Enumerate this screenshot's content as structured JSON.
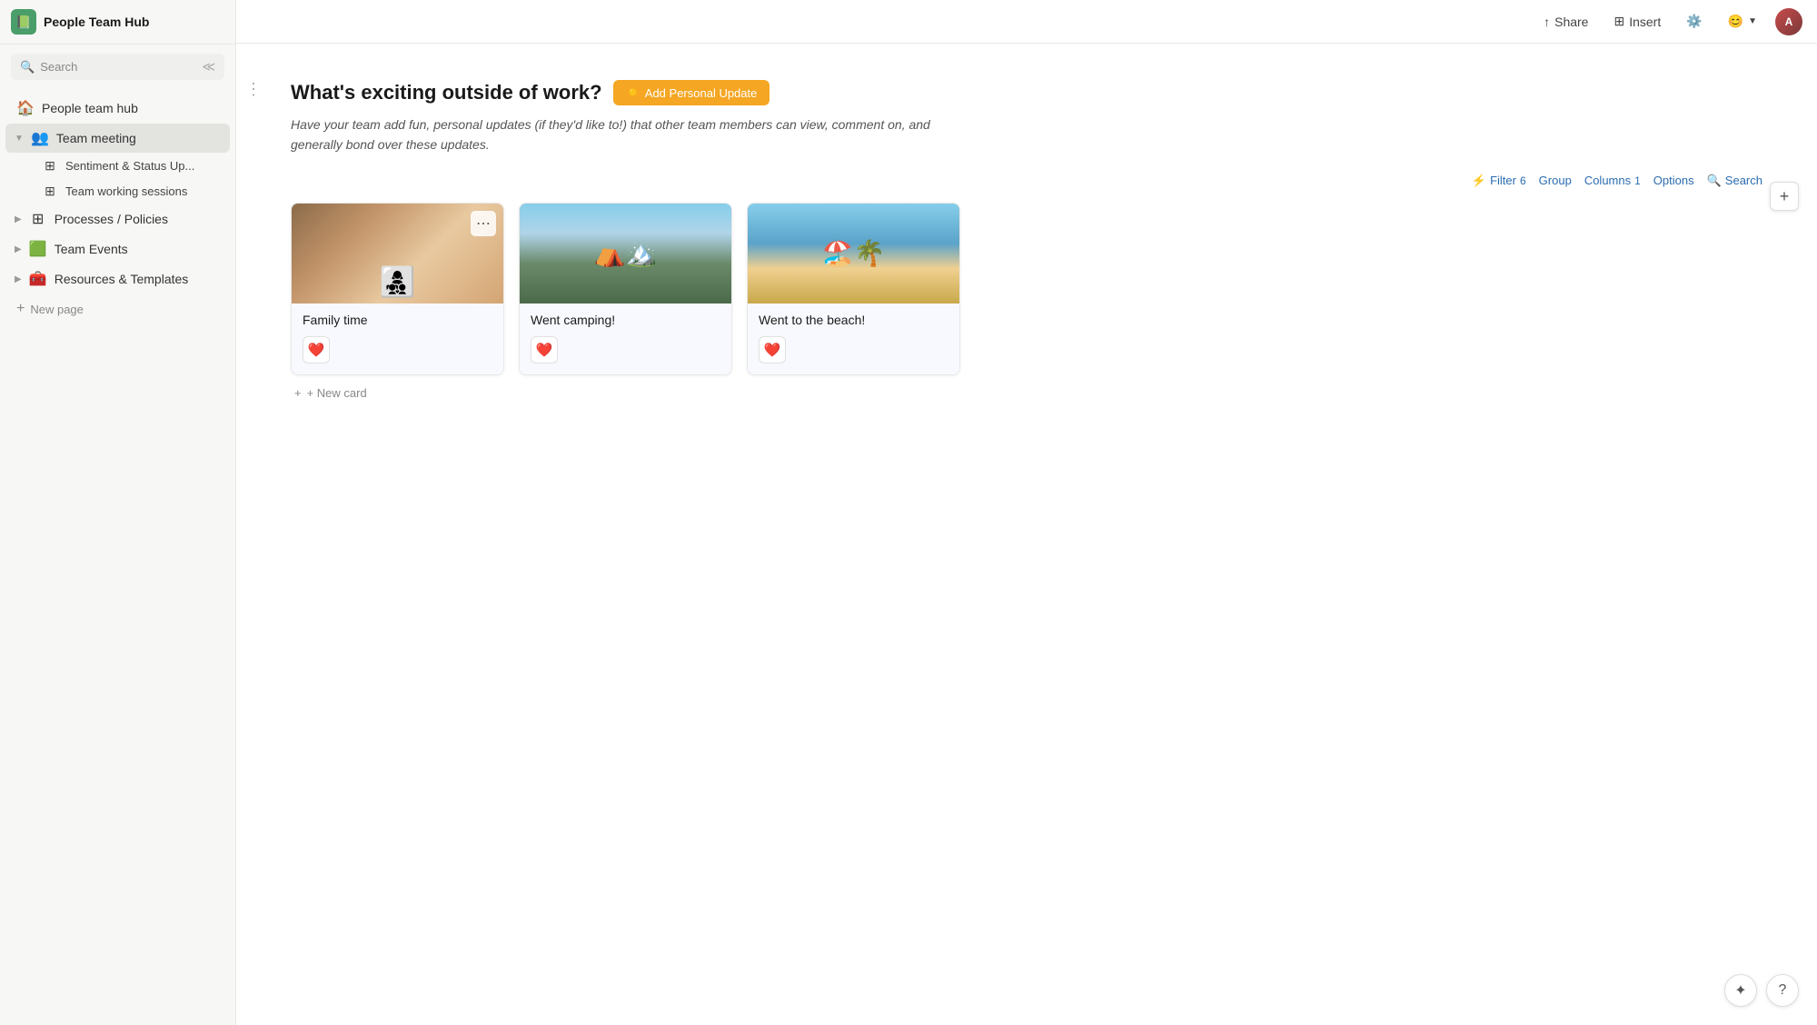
{
  "app": {
    "title": "People Team Hub",
    "logo_emoji": "🟩"
  },
  "sidebar": {
    "search_placeholder": "Search",
    "items": [
      {
        "id": "people-team-hub",
        "label": "People team hub",
        "icon": "🏠",
        "level": 0,
        "expanded": false
      },
      {
        "id": "team-meeting",
        "label": "Team meeting",
        "icon": "👥",
        "level": 0,
        "expanded": true,
        "active": true
      },
      {
        "id": "sentiment-status",
        "label": "Sentiment & Status Up...",
        "icon": "⊞",
        "level": 1
      },
      {
        "id": "team-working-sessions",
        "label": "Team working sessions",
        "icon": "⊞",
        "level": 1
      },
      {
        "id": "processes-policies",
        "label": "Processes / Policies",
        "icon": "⊞",
        "level": 0,
        "expanded": false
      },
      {
        "id": "team-events",
        "label": "Team Events",
        "icon": "🟩",
        "level": 0,
        "expanded": false
      },
      {
        "id": "resources-templates",
        "label": "Resources & Templates",
        "icon": "🧰",
        "level": 0,
        "expanded": false
      }
    ],
    "new_page_label": "New page"
  },
  "topbar": {
    "share_label": "Share",
    "insert_label": "Insert"
  },
  "main": {
    "section_title": "What's exciting outside of work?",
    "add_btn_label": "Add Personal Update",
    "description": "Have your team add fun, personal updates (if they'd like to!) that other team members can view, comment on, and generally bond over these updates.",
    "toolbar": {
      "filter_label": "Filter",
      "filter_count": "6",
      "group_label": "Group",
      "columns_label": "Columns",
      "columns_count": "1",
      "options_label": "Options",
      "search_label": "Search"
    },
    "cards": [
      {
        "id": "family-time",
        "title": "Family time",
        "img_type": "family",
        "heart_count": ""
      },
      {
        "id": "went-camping",
        "title": "Went camping!",
        "img_type": "camping",
        "heart_count": ""
      },
      {
        "id": "went-beach",
        "title": "Went to the beach!",
        "img_type": "beach",
        "heart_count": ""
      }
    ],
    "new_card_label": "+ New card"
  }
}
